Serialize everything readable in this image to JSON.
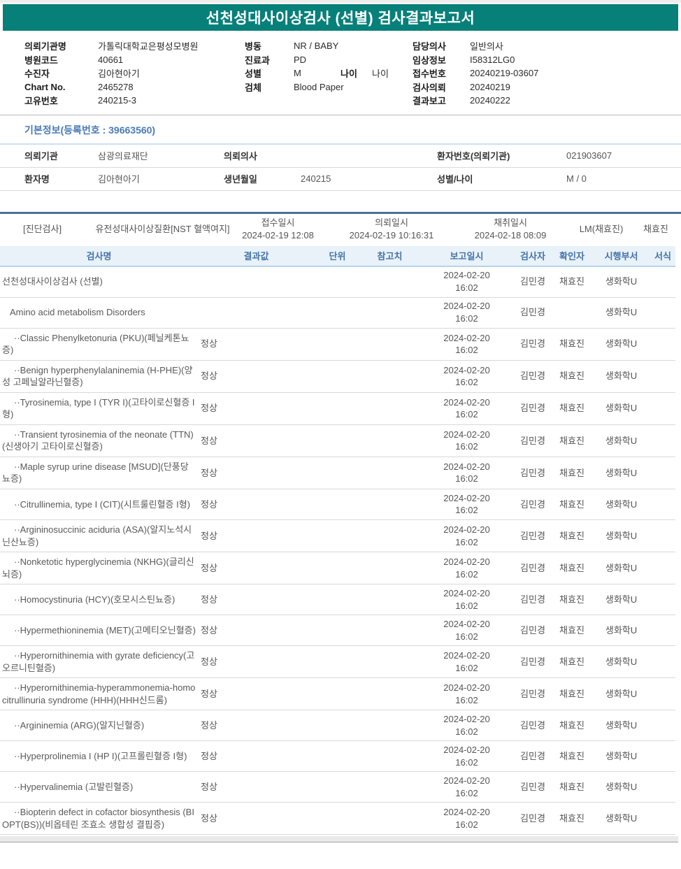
{
  "report": {
    "title": "선천성대사이상검사 (선별) 검사결과보고서"
  },
  "header_info": {
    "columns": [
      {
        "fields": [
          {
            "label": "의뢰기관명",
            "value": "가톨릭대학교은평성모병원"
          },
          {
            "label": "병원코드",
            "value": "40661"
          },
          {
            "label": "수진자",
            "value": "김아현아기"
          },
          {
            "label": "Chart No.",
            "value": "2465278"
          },
          {
            "label": "고유번호",
            "value": "240215-3"
          }
        ]
      },
      {
        "fields": [
          {
            "label": "병동",
            "value": "NR / BABY"
          },
          {
            "label": "진료과",
            "value": "PD"
          },
          {
            "label": "성별",
            "value": "M",
            "label2": "나이",
            "value2": "나이"
          },
          {
            "label": "검체",
            "value": "Blood Paper"
          }
        ]
      },
      {
        "fields": [
          {
            "label": "담당의사",
            "value": "일반의사"
          },
          {
            "label": "임상정보",
            "value": "I58312LG0"
          },
          {
            "label": "접수번호",
            "value": "20240219-03607"
          },
          {
            "label": "검사의뢰",
            "value": "20240219"
          },
          {
            "label": "결과보고",
            "value": "20240222"
          }
        ]
      }
    ]
  },
  "basic_info": {
    "section_title": "기본정보(등록번호 : 39663560)",
    "rows": [
      [
        {
          "label": "의뢰기관",
          "value": "삼광의료재단"
        },
        {
          "label": "의뢰의사",
          "value": ""
        },
        {
          "label": "환자번호(의뢰기관)",
          "value": "021903607"
        }
      ],
      [
        {
          "label": "환자명",
          "value": "김아현아기"
        },
        {
          "label": "생년월일",
          "value": "240215"
        },
        {
          "label": "성별/나이",
          "value": "M / 0"
        }
      ]
    ]
  },
  "diagnosis_band": {
    "tag": "[진단검사]",
    "test_group": "유전성대사이상질환[NST 혈액여지]",
    "received_label": "접수일시",
    "received_datetime": "2024-02-19 12:08",
    "requested_label": "의뢰일시",
    "requested_datetime": "2024-02-19 10:16:31",
    "collected_label": "채취일시",
    "collected_datetime": "2024-02-18 08:09",
    "lab": "LM(채효진)",
    "collector": "채효진"
  },
  "results_table": {
    "headers": [
      "검사명",
      "결과값",
      "단위",
      "참고치",
      "보고일시",
      "검사자",
      "확인자",
      "시행부서",
      "서식"
    ],
    "rows": [
      {
        "name": "선천성대사이상검사 (선별)",
        "level": 0,
        "result": "",
        "unit": "",
        "ref": "",
        "report_date": "2024-02-20",
        "report_time": "16:02",
        "tester": "김민경",
        "confirmer": "채효진",
        "dept": "생화학U",
        "form": ""
      },
      {
        "name": "Amino acid metabolism Disorders",
        "level": 1,
        "result": "",
        "unit": "",
        "ref": "",
        "report_date": "2024-02-20",
        "report_time": "16:02",
        "tester": "김민경",
        "confirmer": "",
        "dept": "생화학U",
        "form": ""
      },
      {
        "name": "··Classic Phenylketonuria (PKU)(페닐케톤뇨증)",
        "level": 2,
        "result": "정상",
        "unit": "",
        "ref": "",
        "report_date": "2024-02-20",
        "report_time": "16:02",
        "tester": "김민경",
        "confirmer": "채효진",
        "dept": "생화학U",
        "form": ""
      },
      {
        "name": "··Benign hyperphenylalaninemia (H-PHE)(양성 고페닐알라닌혈증)",
        "level": 2,
        "result": "정상",
        "unit": "",
        "ref": "",
        "report_date": "2024-02-20",
        "report_time": "16:02",
        "tester": "김민경",
        "confirmer": "채효진",
        "dept": "생화학U",
        "form": ""
      },
      {
        "name": "··Tyrosinemia, type I (TYR I)(고타이로신혈증 I형)",
        "level": 2,
        "result": "정상",
        "unit": "",
        "ref": "",
        "report_date": "2024-02-20",
        "report_time": "16:02",
        "tester": "김민경",
        "confirmer": "채효진",
        "dept": "생화학U",
        "form": ""
      },
      {
        "name": "··Transient tyrosinemia of the neonate (TTN)(신생아기 고타이로신혈증)",
        "level": 2,
        "result": "정상",
        "unit": "",
        "ref": "",
        "report_date": "2024-02-20",
        "report_time": "16:02",
        "tester": "김민경",
        "confirmer": "채효진",
        "dept": "생화학U",
        "form": ""
      },
      {
        "name": "··Maple syrup urine disease [MSUD](단풍당뇨증)",
        "level": 2,
        "result": "정상",
        "unit": "",
        "ref": "",
        "report_date": "2024-02-20",
        "report_time": "16:02",
        "tester": "김민경",
        "confirmer": "채효진",
        "dept": "생화학U",
        "form": ""
      },
      {
        "name": "··Citrullinemia, type I (CIT)(시트룰린혈증 I형)",
        "level": 2,
        "result": "정상",
        "unit": "",
        "ref": "",
        "report_date": "2024-02-20",
        "report_time": "16:02",
        "tester": "김민경",
        "confirmer": "채효진",
        "dept": "생화학U",
        "form": ""
      },
      {
        "name": "··Argininosuccinic aciduria (ASA)(알지노석시닌산뇨증)",
        "level": 2,
        "result": "정상",
        "unit": "",
        "ref": "",
        "report_date": "2024-02-20",
        "report_time": "16:02",
        "tester": "김민경",
        "confirmer": "채효진",
        "dept": "생화학U",
        "form": ""
      },
      {
        "name": "··Nonketotic hyperglycinemia (NKHG)(글리신뇌증)",
        "level": 2,
        "result": "정상",
        "unit": "",
        "ref": "",
        "report_date": "2024-02-20",
        "report_time": "16:02",
        "tester": "김민경",
        "confirmer": "채효진",
        "dept": "생화학U",
        "form": ""
      },
      {
        "name": "··Homocystinuria (HCY)(호모시스틴뇨증)",
        "level": 2,
        "result": "정상",
        "unit": "",
        "ref": "",
        "report_date": "2024-02-20",
        "report_time": "16:02",
        "tester": "김민경",
        "confirmer": "채효진",
        "dept": "생화학U",
        "form": ""
      },
      {
        "name": "··Hypermethioninemia (MET)(고메티오닌혈증)",
        "level": 2,
        "result": "정상",
        "unit": "",
        "ref": "",
        "report_date": "2024-02-20",
        "report_time": "16:02",
        "tester": "김민경",
        "confirmer": "채효진",
        "dept": "생화학U",
        "form": ""
      },
      {
        "name": "··Hyperornithinemia with gyrate deficiency(고오르니틴혈증)",
        "level": 2,
        "result": "정상",
        "unit": "",
        "ref": "",
        "report_date": "2024-02-20",
        "report_time": "16:02",
        "tester": "김민경",
        "confirmer": "채효진",
        "dept": "생화학U",
        "form": ""
      },
      {
        "name": "··Hyperornithinemia-hyperammonemia-homocitrullinuria syndrome (HHH)(HHH신드롬)",
        "level": 2,
        "result": "정상",
        "unit": "",
        "ref": "",
        "report_date": "2024-02-20",
        "report_time": "16:02",
        "tester": "김민경",
        "confirmer": "채효진",
        "dept": "생화학U",
        "form": ""
      },
      {
        "name": "··Argininemia (ARG)(알지닌혈증)",
        "level": 2,
        "result": "정상",
        "unit": "",
        "ref": "",
        "report_date": "2024-02-20",
        "report_time": "16:02",
        "tester": "김민경",
        "confirmer": "채효진",
        "dept": "생화학U",
        "form": ""
      },
      {
        "name": "··Hyperprolinemia I (HP I)(고프롤린혈증 I형)",
        "level": 2,
        "result": "정상",
        "unit": "",
        "ref": "",
        "report_date": "2024-02-20",
        "report_time": "16:02",
        "tester": "김민경",
        "confirmer": "채효진",
        "dept": "생화학U",
        "form": ""
      },
      {
        "name": "··Hypervalinemia (고발린혈증)",
        "level": 2,
        "result": "정상",
        "unit": "",
        "ref": "",
        "report_date": "2024-02-20",
        "report_time": "16:02",
        "tester": "김민경",
        "confirmer": "채효진",
        "dept": "생화학U",
        "form": ""
      },
      {
        "name": "··Biopterin defect in cofactor biosynthesis (BIOPT(BS))(비옵테린 조효소 생합성 결핍증)",
        "level": 2,
        "result": "정상",
        "unit": "",
        "ref": "",
        "report_date": "2024-02-20",
        "report_time": "16:02",
        "tester": "김민경",
        "confirmer": "채효진",
        "dept": "생화학U",
        "form": ""
      }
    ]
  },
  "colors": {
    "title_bar_bg": "#07807a",
    "title_text": "#ffffff",
    "section_title_text": "#4a7ab5",
    "table_header_bg": "#e9f1f9",
    "table_header_text": "#4373aa",
    "band_top_border": "#4a7195",
    "row_border": "#d9d9d9",
    "body_text": "#555555"
  }
}
